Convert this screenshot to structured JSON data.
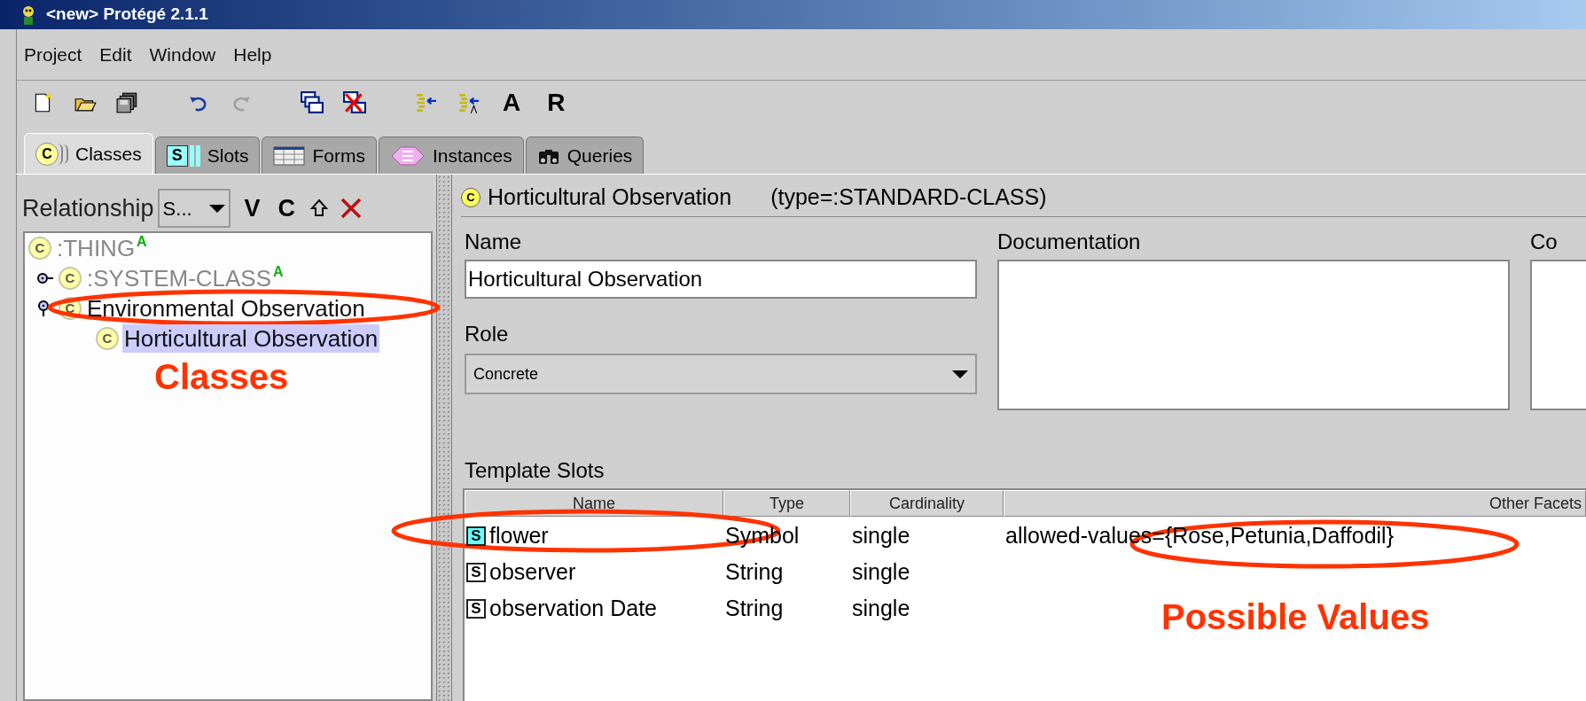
{
  "window": {
    "title": "<new> Protégé 2.1.1"
  },
  "menu": [
    "Project",
    "Edit",
    "Window",
    "Help"
  ],
  "toolbar": {
    "redo_disabled": true,
    "letter_buttons": [
      "A",
      "R"
    ]
  },
  "tabs": [
    {
      "label": "Classes",
      "selected": true,
      "kind": "classes",
      "icon": "C"
    },
    {
      "label": "Slots",
      "selected": false,
      "kind": "slots",
      "icon": "S"
    },
    {
      "label": "Forms",
      "selected": false,
      "kind": "forms"
    },
    {
      "label": "Instances",
      "selected": false,
      "kind": "instances"
    },
    {
      "label": "Queries",
      "selected": false,
      "kind": "queries"
    }
  ],
  "class_panel": {
    "relationship_label": "Relationship",
    "relationship_value": "S...",
    "actions": [
      "V",
      "C"
    ],
    "tree": [
      {
        "label": ":THING",
        "icon": "C",
        "badge": "A",
        "system": true,
        "selected": false,
        "children": [
          {
            "label": ":SYSTEM-CLASS",
            "icon": "C",
            "badge": "A",
            "system": true,
            "expanded": false,
            "selected": false
          },
          {
            "label": "Environmental Observation",
            "icon": "C",
            "system": false,
            "expanded": true,
            "selected": false,
            "children": [
              {
                "label": "Horticultural Observation",
                "icon": "C",
                "system": false,
                "selected": true
              }
            ]
          }
        ]
      }
    ]
  },
  "class_form": {
    "icon": "C",
    "title": "Horticultural Observation",
    "type": "(type=:STANDARD-CLASS)",
    "name_label": "Name",
    "name_value": "Horticultural Observation",
    "documentation_label": "Documentation",
    "constraints_label": "Co",
    "role_label": "Role",
    "role_value": "Concrete",
    "template_slots_label": "Template Slots",
    "columns": [
      "Name",
      "Type",
      "Cardinality",
      "Other Facets"
    ],
    "rows": [
      {
        "icon": "S",
        "name": "flower",
        "type": "Symbol",
        "cardinality": "single",
        "other_facets": "allowed-values={Rose,Petunia,Daffodil}",
        "selected": true
      },
      {
        "icon": "S",
        "name": "observer",
        "type": "String",
        "cardinality": "single",
        "selected": false
      },
      {
        "icon": "S",
        "name": "observation Date",
        "type": "String",
        "cardinality": "single",
        "selected": false
      }
    ]
  },
  "annotations": [
    "Classes",
    "Possible Values"
  ]
}
